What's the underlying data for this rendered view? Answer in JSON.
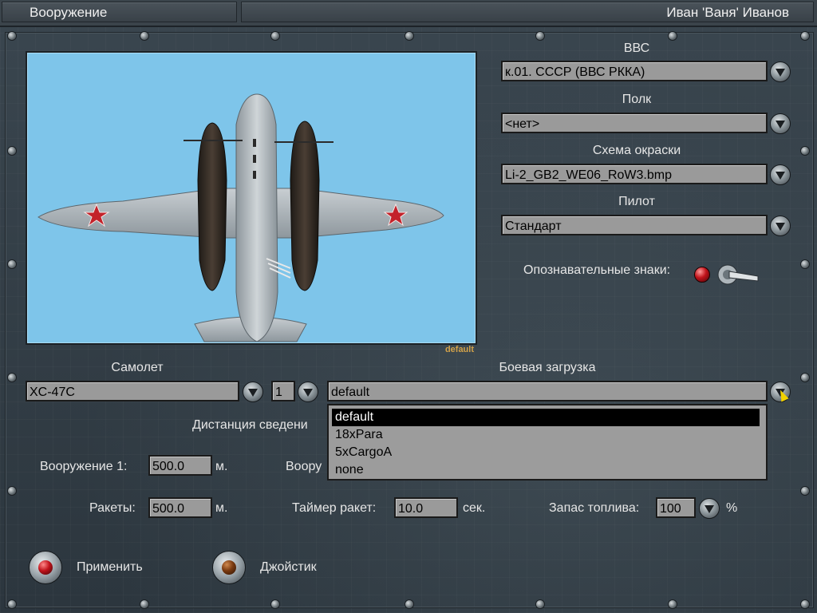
{
  "window": {
    "title": "Вооружение",
    "user": "Иван 'Ваня' Иванов"
  },
  "preview": {
    "caption": "default"
  },
  "right_panel": {
    "airforce_label": "ВВС",
    "airforce_value": "к.01. СССР (ВВС РККА)",
    "regiment_label": "Полк",
    "regiment_value": "<нет>",
    "skin_label": "Схема окраски",
    "skin_value": "Li-2_GB2_WE06_RoW3.bmp",
    "pilot_label": "Пилот",
    "pilot_value": "Стандарт",
    "markings_label": "Опознавательные знаки:"
  },
  "aircraft": {
    "label": "Самолет",
    "value": "XC-47C",
    "number": "1"
  },
  "loadout": {
    "label": "Боевая загрузка",
    "value": "default",
    "options": [
      "default",
      "18xPara",
      "5xCargoA",
      "none"
    ],
    "selected_index": 0
  },
  "convergence": {
    "label": "Дистанция сведени",
    "weapon1_label": "Вооружение 1:",
    "weapon1_value": "500.0",
    "weapon1_unit": "м.",
    "weapon2_label_partial": "Воору",
    "rockets_label": "Ракеты:",
    "rockets_value": "500.0",
    "rockets_unit": "м.",
    "rocket_timer_label": "Таймер ракет:",
    "rocket_timer_value": "10.0",
    "rocket_timer_unit": "сек.",
    "fuel_label": "Запас топлива:",
    "fuel_value": "100",
    "fuel_unit": "%"
  },
  "buttons": {
    "apply_label": "Применить",
    "joystick_label": "Джойстик"
  },
  "colors": {
    "preview_bg": "#7ec5ea",
    "field_bg": "#9a9a9a",
    "caption": "#d2a24a",
    "apply_lamp": "#c0121a",
    "joystick_lamp": "#7a3a10"
  }
}
